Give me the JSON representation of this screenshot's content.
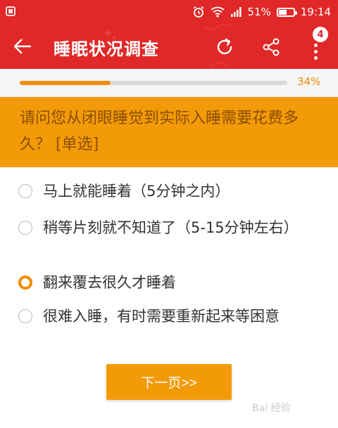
{
  "status_bar": {
    "battery": "51%",
    "time": "19:14"
  },
  "toolbar": {
    "title": "睡眠状况调查",
    "badge_count": "4",
    "icons": [
      "back-arrow-icon",
      "refresh-icon",
      "share-icon",
      "more-vertical-icon"
    ]
  },
  "progress": {
    "percent_label": "34%",
    "value": 0.34
  },
  "question": {
    "text": "请问您从闭眼睡觉到实际入睡需要花费多久？ [单选]"
  },
  "options": [
    {
      "label": "马上就能睡着（5分钟之内）",
      "selected": false
    },
    {
      "label": "稍等片刻就不知道了（5-15分钟左右）",
      "selected": false
    },
    {
      "label": "翻来覆去很久才睡着",
      "selected": true
    },
    {
      "label": "很难入睡，有时需要重新起来等困意",
      "selected": false
    }
  ],
  "next_button": {
    "label": "下一页>>"
  },
  "watermark": {
    "text": "Bai 经验"
  },
  "colors": {
    "header_red": "#e02828",
    "accent_orange": "#f39a08",
    "question_text": "#8a4f00"
  }
}
